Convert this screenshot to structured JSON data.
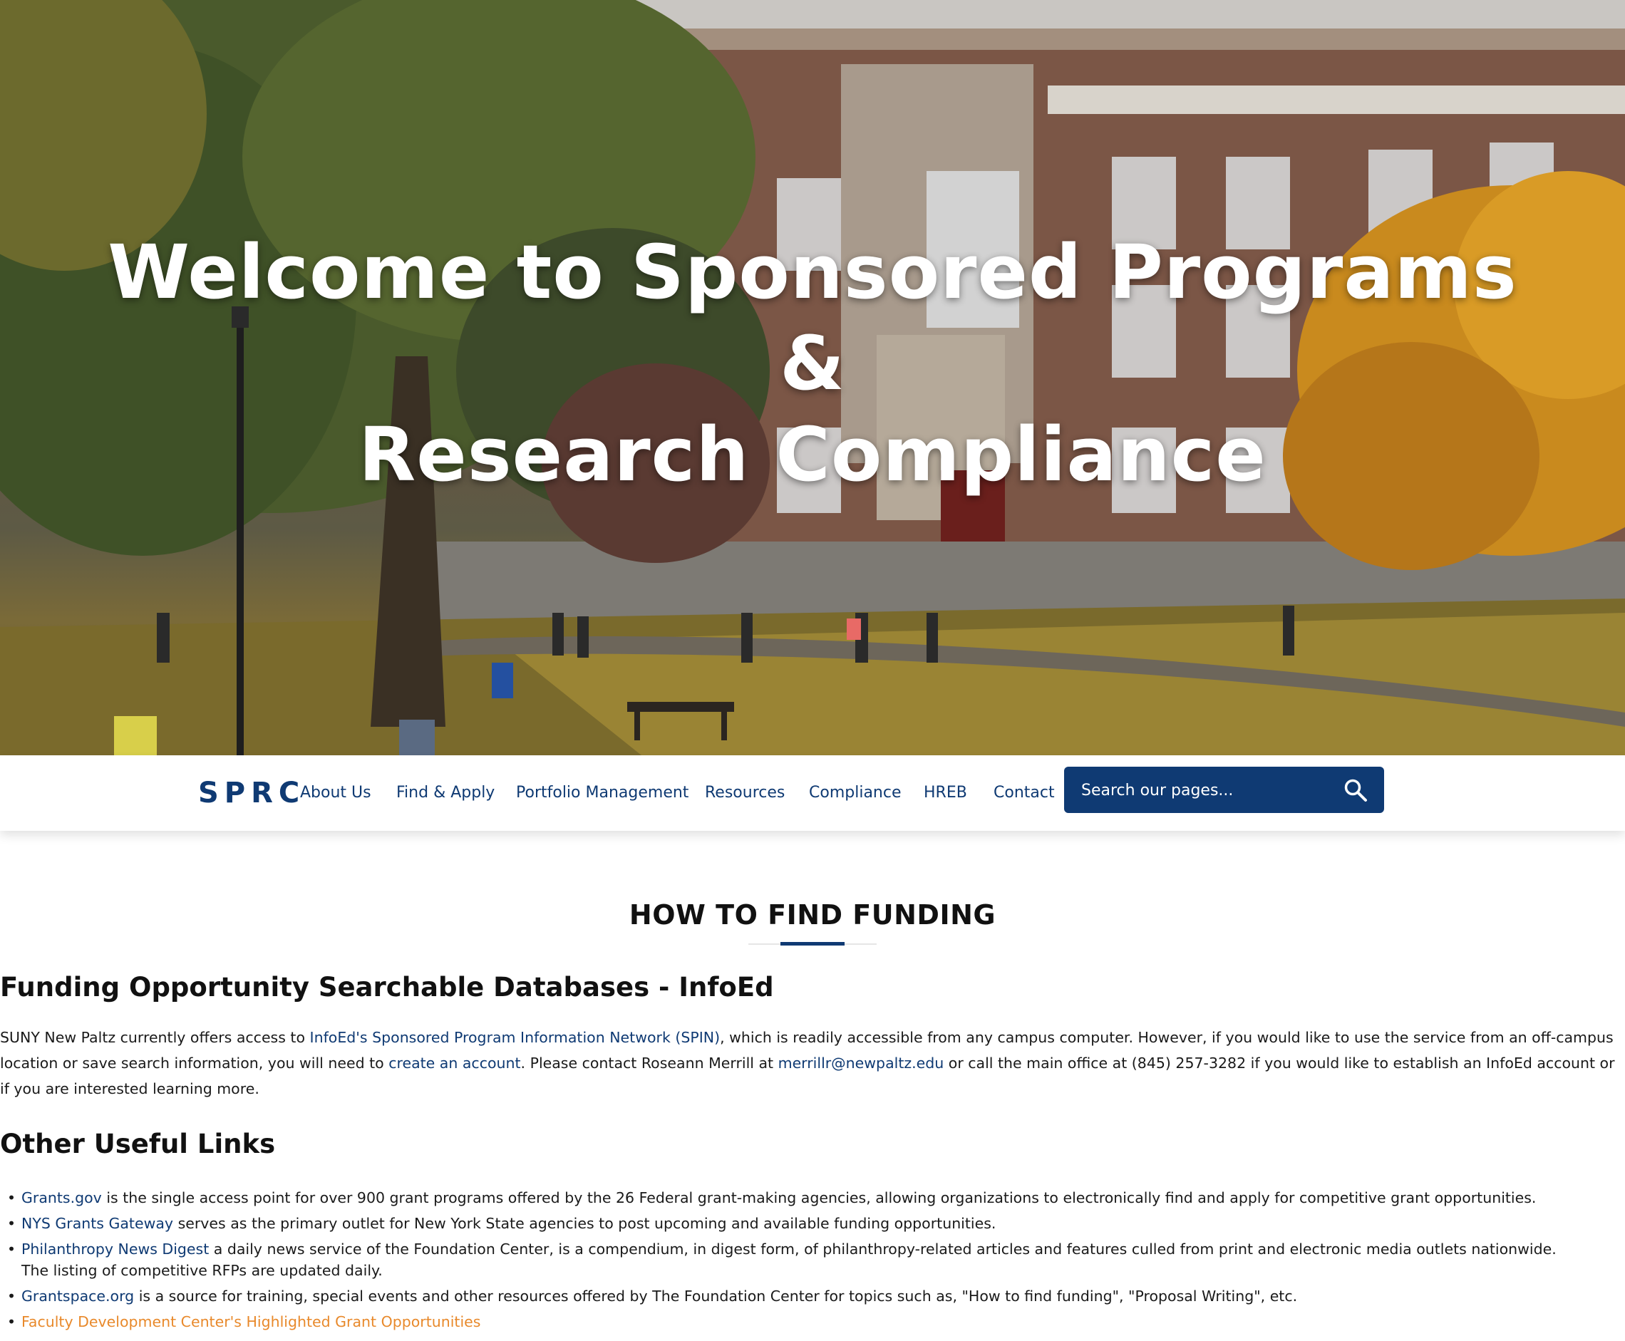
{
  "hero": {
    "title_line1": "Welcome to Sponsored Programs",
    "title_line2": "&",
    "title_line3": "Research Compliance"
  },
  "nav": {
    "brand": "SPRC",
    "items": [
      {
        "label": "About Us"
      },
      {
        "label": "Find & Apply"
      },
      {
        "label": "Portfolio Management"
      },
      {
        "label": "Resources"
      },
      {
        "label": "Compliance"
      },
      {
        "label": "HREB"
      },
      {
        "label": "Contact"
      }
    ],
    "search": {
      "placeholder": "Search our pages...",
      "icon": "search-icon"
    }
  },
  "main": {
    "section_title": "HOW TO FIND FUNDING",
    "infoed": {
      "heading": "Funding Opportunity Searchable Databases - InfoEd",
      "text_1": "SUNY New Paltz currently offers access to ",
      "link_spin": "InfoEd's Sponsored Program Information Network (SPIN)",
      "text_2": ", which is readily accessible from any campus computer. However, if you would like to use the service from an off-campus location or save search information, you will need to ",
      "link_account": "create an account",
      "text_3": ". Please contact Roseann Merrill at ",
      "link_email": "merrillr@newpaltz.edu",
      "text_4": " or call the main office at (845) 257-3282 if you would like to establish an InfoEd account or if you are interested learning more."
    },
    "other": {
      "heading": "Other Useful Links",
      "items": [
        {
          "link": "Grants.gov",
          "text": " is the single access point for over 900 grant programs offered by the 26 Federal grant-making agencies, allowing organizations to electronically find and apply for competitive grant opportunities."
        },
        {
          "link": "NYS Grants Gateway",
          "text": " serves as the primary outlet for New York State agencies to post upcoming and available funding opportunities."
        },
        {
          "link": "Philanthropy News Digest",
          "text": " a daily news service of the Foundation Center, is a compendium, in digest form, of philanthropy-related articles and features culled from print and electronic media outlets nationwide.",
          "text_line2": "The listing of competitive RFPs are updated daily."
        },
        {
          "link": "Grantspace.org",
          "text": " is a source for training, special events and other resources offered by The Foundation Center for topics such as, \"How to find funding\", \"Proposal Writing\", etc."
        },
        {
          "link": "Faculty Development Center's Highlighted Grant Opportunities",
          "text": ""
        }
      ]
    }
  },
  "colors": {
    "brand_navy": "#0f3a73",
    "link_orange": "#e8892b",
    "text": "#1a1a1a"
  }
}
